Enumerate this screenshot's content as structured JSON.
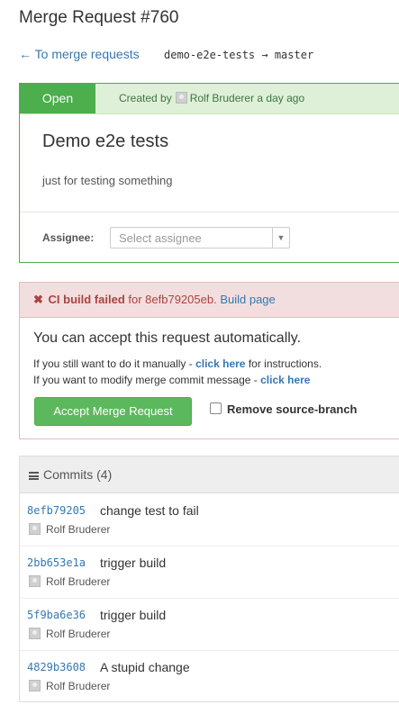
{
  "page": {
    "title": "Merge Request #760"
  },
  "nav": {
    "back_label": "← To merge requests",
    "branches": "demo-e2e-tests → master"
  },
  "merge_request": {
    "status": "Open",
    "created_prefix": "Created by",
    "author": "Rolf Bruderer",
    "created_suffix": "a day ago",
    "title": "Demo e2e tests",
    "description": "just for testing something",
    "assignee_label": "Assignee:",
    "assignee_placeholder": "Select assignee"
  },
  "ci": {
    "icon": "x-icon",
    "failed_label": "CI build failed",
    "for_text": "for 8efb79205eb.",
    "build_link": "Build page"
  },
  "accept": {
    "title": "You can accept this request automatically.",
    "manual_prefix": "If you still want to do it manually -",
    "manual_link": "click here",
    "manual_suffix": "for instructions.",
    "modify_prefix": "If you want to modify merge commit message -",
    "modify_link": "click here",
    "button_label": "Accept Merge Request",
    "remove_branch_label": "Remove source-branch"
  },
  "commits": {
    "label": "Commits",
    "count": "(4)",
    "items": [
      {
        "sha": "8efb79205",
        "message": "change test to fail",
        "author": "Rolf Bruderer"
      },
      {
        "sha": "2bb653e1a",
        "message": "trigger build",
        "author": "Rolf Bruderer"
      },
      {
        "sha": "5f9ba6e36",
        "message": "trigger build",
        "author": "Rolf Bruderer"
      },
      {
        "sha": "4829b3608",
        "message": "A stupid change",
        "author": "Rolf Bruderer"
      }
    ]
  },
  "colors": {
    "success": "#5cb85c",
    "danger_text": "#a94442",
    "link": "#3777b0"
  }
}
